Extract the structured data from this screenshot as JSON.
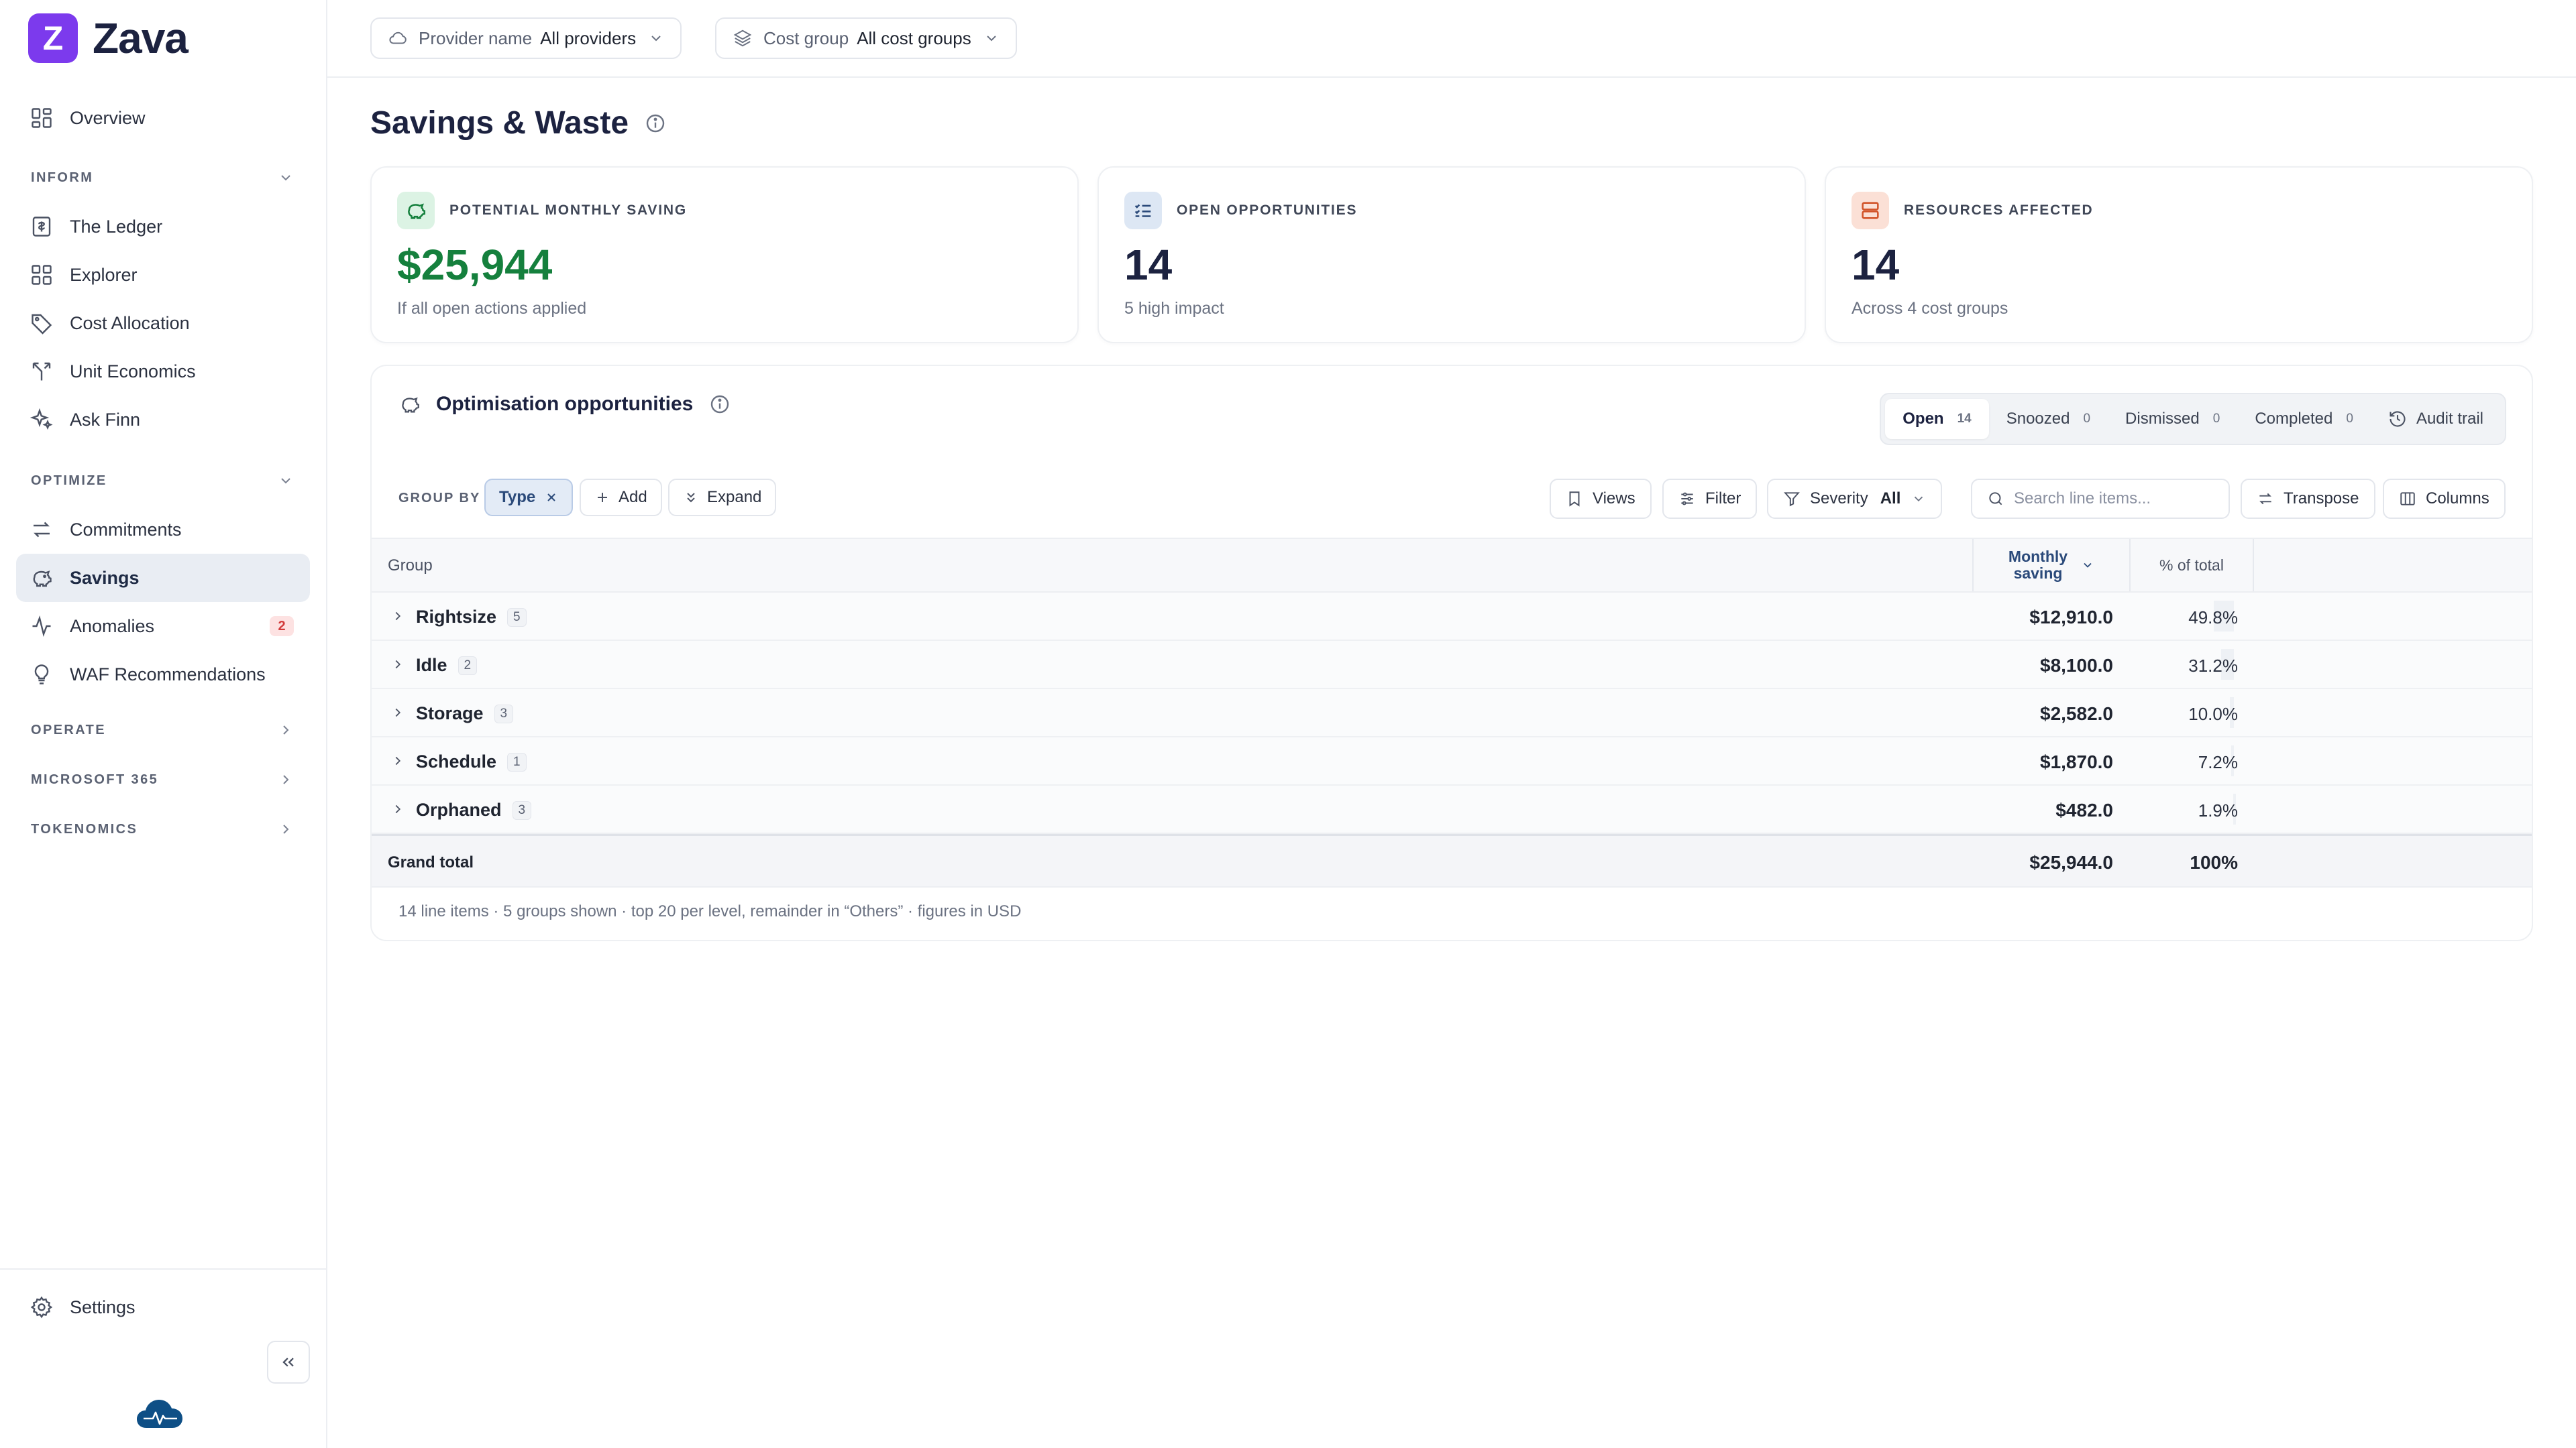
{
  "brand": {
    "letter": "Z",
    "name": "Zava"
  },
  "topbar": {
    "provider": {
      "label": "Provider name",
      "value": "All providers"
    },
    "cost_group": {
      "label": "Cost group",
      "value": "All cost groups"
    }
  },
  "sidebar": {
    "overview": "Overview",
    "sections": {
      "inform": "INFORM",
      "optimize": "OPTIMIZE",
      "operate": "OPERATE",
      "m365": "MICROSOFT 365",
      "tokenomics": "TOKENOMICS"
    },
    "inform_items": [
      "The Ledger",
      "Explorer",
      "Cost Allocation",
      "Unit Economics",
      "Ask Finn"
    ],
    "optimize_items": [
      "Commitments",
      "Savings",
      "Anomalies",
      "WAF Recommendations"
    ],
    "anomalies_badge": "2",
    "settings": "Settings"
  },
  "page": {
    "title": "Savings & Waste"
  },
  "kpis": [
    {
      "label": "POTENTIAL MONTHLY SAVING",
      "value": "$25,944",
      "sub": "If all open actions applied",
      "color": "#15803d"
    },
    {
      "label": "OPEN OPPORTUNITIES",
      "value": "14",
      "sub": "5 high impact",
      "color": "#1c2240"
    },
    {
      "label": "RESOURCES AFFECTED",
      "value": "14",
      "sub": "Across 4 cost groups",
      "color": "#1c2240"
    }
  ],
  "panel": {
    "title": "Optimisation opportunities",
    "status_tabs": [
      {
        "label": "Open",
        "count": "14"
      },
      {
        "label": "Snoozed",
        "count": "0"
      },
      {
        "label": "Dismissed",
        "count": "0"
      },
      {
        "label": "Completed",
        "count": "0"
      }
    ],
    "audit_trail": "Audit trail",
    "toolbar": {
      "group_by": "GROUP BY",
      "type_chip": "Type",
      "add": "Add",
      "expand": "Expand",
      "views": "Views",
      "filter": "Filter",
      "severity_label": "Severity",
      "severity_value": "All",
      "search_placeholder": "Search line items...",
      "transpose": "Transpose",
      "columns": "Columns"
    },
    "table": {
      "headers": {
        "group": "Group",
        "saving_line1": "Monthly",
        "saving_line2": "saving",
        "pct": "% of total"
      },
      "rows": [
        {
          "name": "Rightsize",
          "count": "5",
          "amount": "$12,910.0",
          "pct": "49.8%",
          "share": 0.498
        },
        {
          "name": "Idle",
          "count": "2",
          "amount": "$8,100.0",
          "pct": "31.2%",
          "share": 0.312
        },
        {
          "name": "Storage",
          "count": "3",
          "amount": "$2,582.0",
          "pct": "10.0%",
          "share": 0.1
        },
        {
          "name": "Schedule",
          "count": "1",
          "amount": "$1,870.0",
          "pct": "7.2%",
          "share": 0.072
        },
        {
          "name": "Orphaned",
          "count": "3",
          "amount": "$482.0",
          "pct": "1.9%",
          "share": 0.019
        }
      ],
      "total": {
        "label": "Grand total",
        "amount": "$25,944.0",
        "pct": "100%"
      }
    },
    "footnote": "14 line items · 5 groups shown · top 20 per level, remainder in “Others” · figures in USD"
  },
  "colors": {
    "accent": "#7c3aed",
    "positive": "#15803d",
    "header_link": "#2b4a7a"
  }
}
